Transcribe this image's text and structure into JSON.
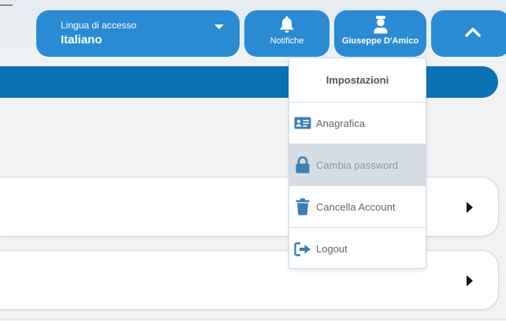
{
  "language": {
    "caption": "Lingua di accesso",
    "selected": "Italiano"
  },
  "notifications": {
    "label": "Notifiche"
  },
  "user": {
    "name": "Giuseppe D'Amico"
  },
  "menu": {
    "title": "Impostazioni",
    "items": [
      {
        "label": "Anagrafica",
        "icon": "id-card-icon"
      },
      {
        "label": "Cambia password",
        "icon": "lock-icon"
      },
      {
        "label": "Cancella Account",
        "icon": "trash-icon"
      },
      {
        "label": "Logout",
        "icon": "logout-icon"
      }
    ],
    "active_index": 1
  },
  "colors": {
    "primary": "#2a8bd3",
    "bar": "#0c72b6",
    "menu_icon": "#3a7fb9"
  }
}
